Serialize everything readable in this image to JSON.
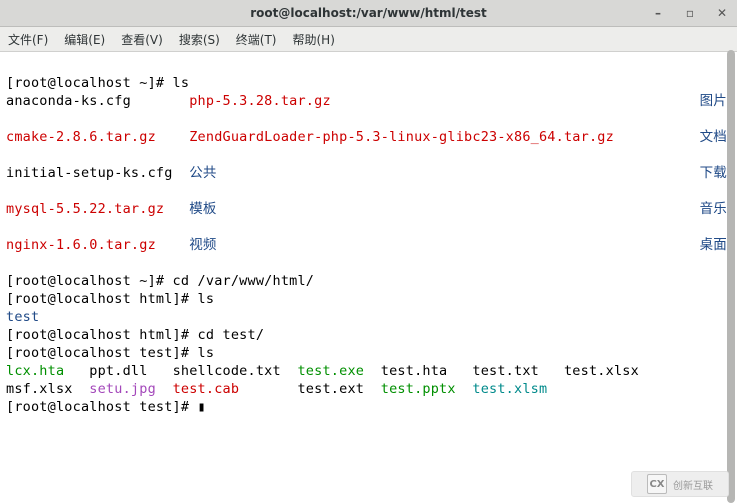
{
  "window": {
    "title": "root@localhost:/var/www/html/test",
    "buttons": {
      "min": "–",
      "max": "▫",
      "close": "✕"
    }
  },
  "menubar": {
    "file": "文件(F)",
    "edit": "编辑(E)",
    "view": "查看(V)",
    "search": "搜索(S)",
    "term": "终端(T)",
    "help": "帮助(H)"
  },
  "terminal": {
    "prompt_home": "[root@localhost ~]#",
    "prompt_html": "[root@localhost html]#",
    "prompt_test": "[root@localhost test]#",
    "cmd_ls": " ls",
    "cmd_cd_var": " cd /var/www/html/",
    "cmd_cd_test": " cd test/",
    "home_ls": {
      "col1_plain": "anaconda-ks.cfg",
      "col1_red_a": "cmake-2.8.6.tar.gz",
      "col1_plain_b": "initial-setup-ks.cfg",
      "col1_red_c": "mysql-5.5.22.tar.gz",
      "col1_red_d": "nginx-1.6.0.tar.gz",
      "col2_red_a": "php-5.3.28.tar.gz",
      "col2_red_b": "ZendGuardLoader-php-5.3-linux-glibc23-x86_64.tar.gz",
      "col2_blue_a": "公共",
      "col2_blue_b": "模板",
      "col2_blue_c": "视频",
      "right_blue_a": "图片",
      "right_blue_b": "文档",
      "right_blue_c": "下载",
      "right_blue_d": "音乐",
      "right_blue_e": "桌面"
    },
    "html_ls": {
      "test_dir": "test"
    },
    "test_ls": {
      "r1_green_a": "lcx.hta",
      "r1_plain_b": "ppt.dll",
      "r1_plain_c": "shellcode.txt",
      "r1_green_d": "test.exe",
      "r1_plain_e": "test.hta",
      "r1_plain_f": "test.txt",
      "r1_plain_g": "test.xlsx",
      "r2_plain_a": "msf.xlsx",
      "r2_magenta_b": "setu.jpg",
      "r2_red_c": "test.cab",
      "r2_plain_d": "test.ext",
      "r2_green_e": "test.pptx",
      "r2_cyan_f": "test.xlsm"
    }
  },
  "watermark": {
    "logo": "CX",
    "text": "创新互联"
  }
}
